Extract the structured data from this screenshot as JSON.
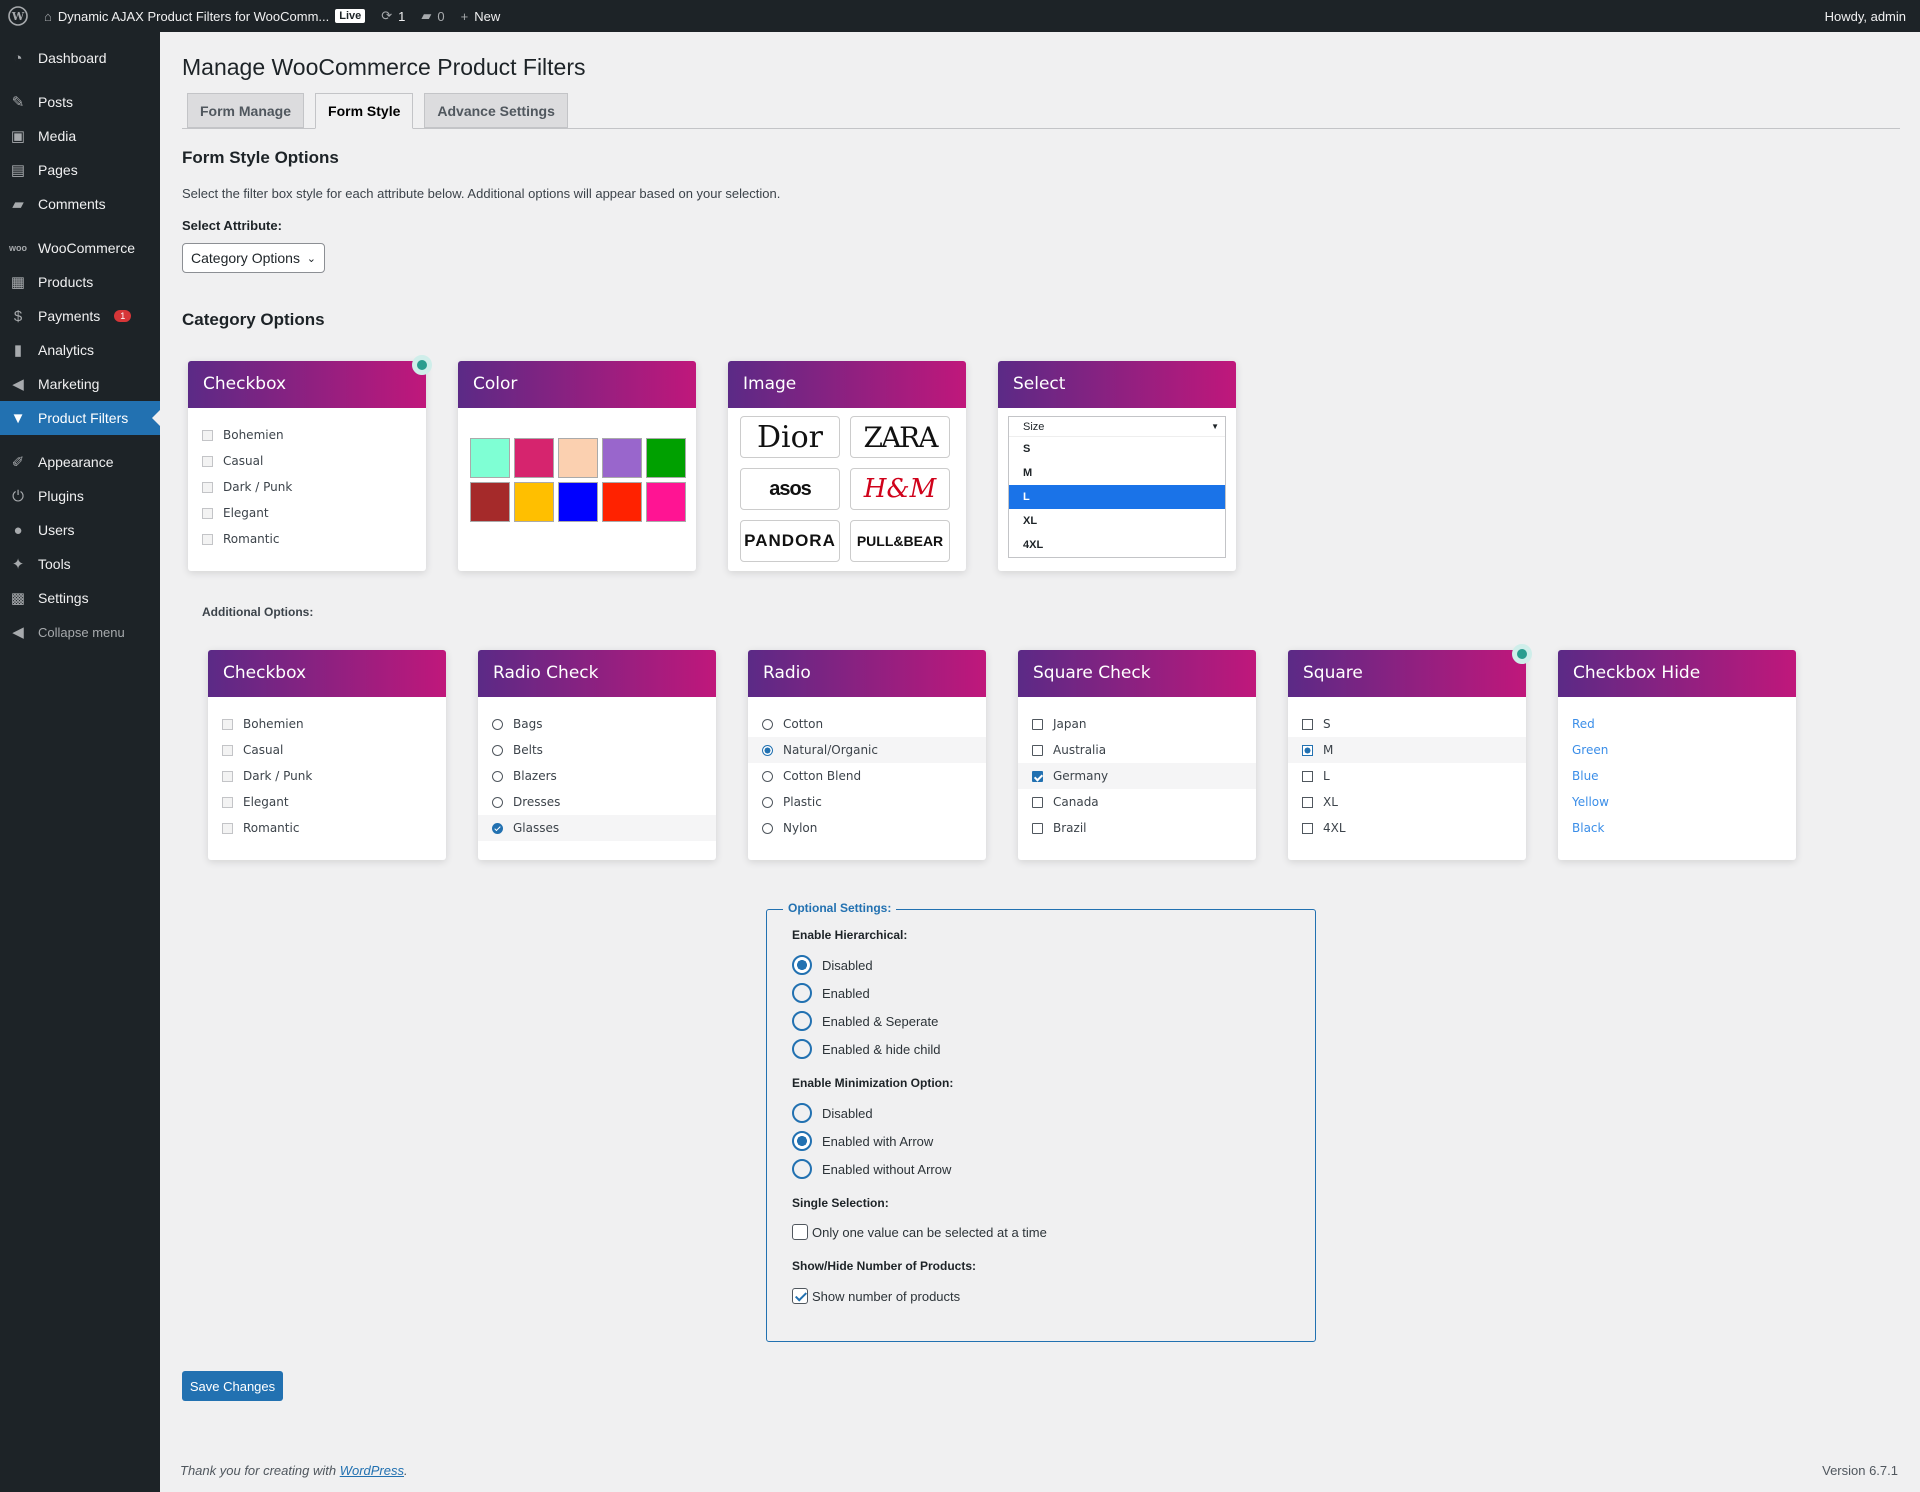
{
  "adminbar": {
    "site_name": "Dynamic AJAX Product Filters for WooComm...",
    "live": "Live",
    "updates": "1",
    "comments": "0",
    "new_label": "New",
    "howdy": "Howdy, admin"
  },
  "sidebar": {
    "items": [
      {
        "label": "Dashboard",
        "icon": "dashboard-icon"
      },
      {
        "label": "Posts",
        "icon": "pin-icon"
      },
      {
        "label": "Media",
        "icon": "media-icon"
      },
      {
        "label": "Pages",
        "icon": "page-icon"
      },
      {
        "label": "Comments",
        "icon": "comment-icon"
      },
      {
        "label": "WooCommerce",
        "icon": "woo-icon"
      },
      {
        "label": "Products",
        "icon": "archive-icon"
      },
      {
        "label": "Payments",
        "icon": "dollar-icon",
        "badge": "1"
      },
      {
        "label": "Analytics",
        "icon": "chart-icon"
      },
      {
        "label": "Marketing",
        "icon": "megaphone-icon"
      },
      {
        "label": "Product Filters",
        "icon": "filter-icon"
      },
      {
        "label": "Appearance",
        "icon": "brush-icon"
      },
      {
        "label": "Plugins",
        "icon": "plug-icon"
      },
      {
        "label": "Users",
        "icon": "user-icon"
      },
      {
        "label": "Tools",
        "icon": "wrench-icon"
      },
      {
        "label": "Settings",
        "icon": "settings-icon"
      }
    ],
    "collapse": "Collapse menu"
  },
  "page": {
    "title": "Manage WooCommerce Product Filters",
    "tabs": [
      "Form Manage",
      "Form Style",
      "Advance Settings"
    ],
    "section_title": "Form Style Options",
    "description": "Select the filter box style for each attribute below. Additional options will appear based on your selection.",
    "select_label": "Select Attribute:",
    "select_value": "Category Options",
    "category_title": "Category Options",
    "additional_label": "Additional Options:"
  },
  "cards": {
    "checkbox": {
      "title": "Checkbox",
      "items": [
        "Bohemien",
        "Casual",
        "Dark / Punk",
        "Elegant",
        "Romantic"
      ]
    },
    "color": {
      "title": "Color",
      "swatches": [
        "#7fffd4",
        "#d6246e",
        "#fbd0b0",
        "#9966cc",
        "#00a000",
        "#a52a2a",
        "#ffbf00",
        "#0000ff",
        "#ff2200",
        "#ff1493"
      ]
    },
    "image": {
      "title": "Image",
      "logos": [
        "Dior",
        "ZARA",
        "asos",
        "H&M",
        "PANDORA",
        "PULL&BEAR"
      ]
    },
    "select": {
      "title": "Select",
      "placeholder": "Size",
      "options": [
        "S",
        "M",
        "L",
        "XL",
        "4XL"
      ],
      "selected": "L"
    }
  },
  "additional": {
    "checkbox": {
      "title": "Checkbox",
      "items": [
        "Bohemien",
        "Casual",
        "Dark / Punk",
        "Elegant",
        "Romantic"
      ]
    },
    "radio_check": {
      "title": "Radio Check",
      "items": [
        "Bags",
        "Belts",
        "Blazers",
        "Dresses",
        "Glasses"
      ]
    },
    "radio": {
      "title": "Radio",
      "items": [
        "Cotton",
        "Natural/Organic",
        "Cotton Blend",
        "Plastic",
        "Nylon"
      ]
    },
    "square_check": {
      "title": "Square Check",
      "items": [
        "Japan",
        "Australia",
        "Germany",
        "Canada",
        "Brazil"
      ]
    },
    "square": {
      "title": "Square",
      "items": [
        "S",
        "M",
        "L",
        "XL",
        "4XL"
      ]
    },
    "checkbox_hide": {
      "title": "Checkbox Hide",
      "items": [
        "Red",
        "Green",
        "Blue",
        "Yellow",
        "Black"
      ]
    }
  },
  "optional": {
    "legend": "Optional Settings:",
    "hier_label": "Enable Hierarchical:",
    "hier": [
      "Disabled",
      "Enabled",
      "Enabled & Seperate",
      "Enabled & hide child"
    ],
    "min_label": "Enable Minimization Option:",
    "min": [
      "Disabled",
      "Enabled with Arrow",
      "Enabled without Arrow"
    ],
    "single_label": "Single Selection:",
    "single_text": "Only one value can be selected at a time",
    "count_label": "Show/Hide Number of Products:",
    "count_text": "Show number of products"
  },
  "save_label": "Save Changes",
  "footer": {
    "text": "Thank you for creating with ",
    "link": "WordPress",
    "dot": ".",
    "version": "Version 6.7.1"
  }
}
